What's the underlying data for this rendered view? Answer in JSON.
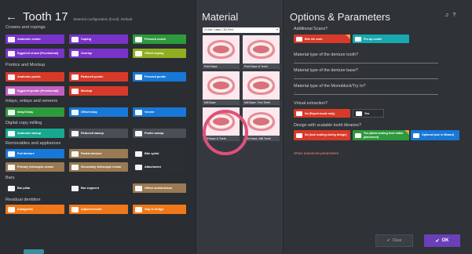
{
  "header": {
    "back_glyph": "←",
    "title": "Tooth 17",
    "subtitle": "Material configuration (local): Default"
  },
  "sections": {
    "crowns": "Crowns and copings",
    "pontics": "Pontics and Mockup",
    "inlays": "Inlays, onlays and veneers",
    "milling": "Digital copy milling",
    "removables": "Removables and appliances",
    "bars": "Bars",
    "residual": "Residual dentition"
  },
  "tiles": {
    "anatomic_crown": "Anatomic crown",
    "coping": "Coping",
    "pressed_crown": "Pressed crown",
    "eggshell_crown": "Eggshell crown (Provisional)",
    "overlay": "Overlay",
    "offset_coping": "Offset coping",
    "anatomic_pontic": "Anatomic pontic",
    "reduced_pontic": "Reduced pontic",
    "pressed_pontic": "Pressed pontic",
    "eggshell_pontic": "Eggshell pontic (Provisional)",
    "mockup": "Mockup",
    "inlay_onlay": "Inlay/Onlay",
    "offset_inlay": "Offset inlay",
    "veneer": "Veneer",
    "anatomic_waxup": "Anatomic waxup",
    "reduced_waxup": "Reduced waxup",
    "pontic_waxup": "Pontic waxup",
    "full_denture": "Full denture",
    "partial_denture": "Partial denture",
    "bite_splint": "Bite splint",
    "primary_telescopic": "Primary telescopic crown",
    "secondary_telescopic": "Secondary telescopic crown",
    "attachment": "Attachment",
    "bar_pillar": "Bar pillar",
    "bar_segment": "Bar segment",
    "offset_substructure": "Offset substructure",
    "antagonist": "Antagonist",
    "adjacent_tooth": "Adjacent tooth",
    "gap_in_bridge": "Gap in bridge"
  },
  "colors": {
    "green": "#2e9a3e",
    "purple": "#7a33c9",
    "lime": "#8fae22",
    "red": "#d83a2a",
    "blue": "#1878d8",
    "teal": "#18a890",
    "orange": "#f0781a",
    "tan": "#9a7a52",
    "pink": "#e04090",
    "accent": "#6b3fb8"
  },
  "material": {
    "title": "Material",
    "select_value": "3-Unit / Lasm / 3D Print",
    "cards": [
      "Print Base",
      "Print Base & Teeth",
      "Mill Base",
      "Mill Base, Trim Teeth",
      "Mill Base & Teeth",
      "Print Base, Mill Teeth"
    ]
  },
  "options": {
    "title": "Options & Parameters",
    "icons": [
      "bell-icon",
      "help-icon"
    ],
    "q_scans": "Additional Scans?",
    "scan_btn1": "Bite rim scan",
    "scan_btn2": "Pre-op model",
    "q_denture_tooth": "Material type of the denture tooth?",
    "q_denture_base": "Material type of the denture base?",
    "q_monoblock": "Material type of the Monoblock/Try In?",
    "empty_value": "–",
    "q_extraction": "Virtual extraction?",
    "ext_no": "No (Expert mode only)",
    "ext_yes": "Yes",
    "q_libraries": "Design with scalable tooth libraries?",
    "lib_no": "No (lock scaling during design)",
    "lib_yes": "Yes (allow scaling from initial placement)",
    "lib_opt": "Optional (ask in Wizard)",
    "advanced": "Show advanced parameters"
  },
  "footer": {
    "clear": "Clear",
    "ok": "OK",
    "check": "✔"
  }
}
